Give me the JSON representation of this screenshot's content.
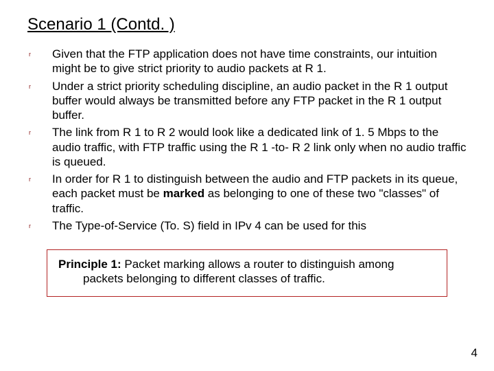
{
  "title": "Scenario 1 (Contd. )",
  "bullets": [
    "Given that the FTP application does not have time constraints, our intuition might be to give strict priority to audio packets at R 1.",
    "Under a strict priority scheduling discipline, an audio packet in the R 1 output buffer would always be transmitted before any FTP packet in the R 1 output buffer.",
    "The link from R 1 to R 2 would look like a dedicated link of 1. 5 Mbps to the audio traffic, with FTP traffic using the R 1 -to- R 2 link only when no audio traffic is queued.",
    "In order for R 1 to distinguish between the audio and FTP packets in its queue, each packet must be <b>marked</b> as belonging to one of these two \"classes\" of traffic.",
    "The Type-of-Service (To. S) field in IPv 4 can be used for this"
  ],
  "principle": {
    "label": "Principle 1: ",
    "text": "Packet marking allows a router to distinguish among packets belonging to different classes of traffic."
  },
  "page_number": "4",
  "bullet_glyph": "r"
}
